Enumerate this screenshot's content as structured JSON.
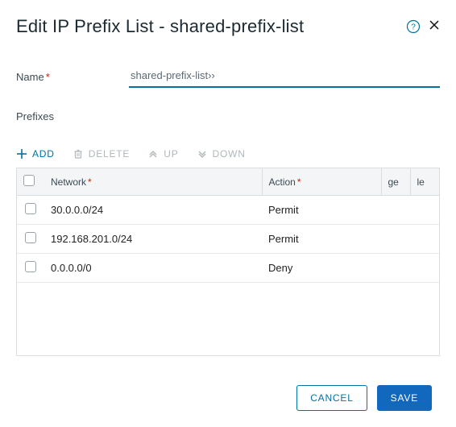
{
  "dialog": {
    "title": "Edit IP Prefix List - shared-prefix-list"
  },
  "form": {
    "name_label": "Name",
    "name_value": "shared-prefix-list››",
    "prefixes_label": "Prefixes"
  },
  "toolbar": {
    "add": "ADD",
    "delete": "DELETE",
    "up": "UP",
    "down": "DOWN"
  },
  "columns": {
    "network": "Network",
    "action": "Action",
    "ge": "ge",
    "le": "le"
  },
  "rows": [
    {
      "network": "30.0.0.0/24",
      "action": "Permit",
      "ge": "",
      "le": ""
    },
    {
      "network": "192.168.201.0/24",
      "action": "Permit",
      "ge": "",
      "le": ""
    },
    {
      "network": "0.0.0.0/0",
      "action": "Deny",
      "ge": "",
      "le": ""
    }
  ],
  "buttons": {
    "cancel": "CANCEL",
    "save": "SAVE"
  }
}
